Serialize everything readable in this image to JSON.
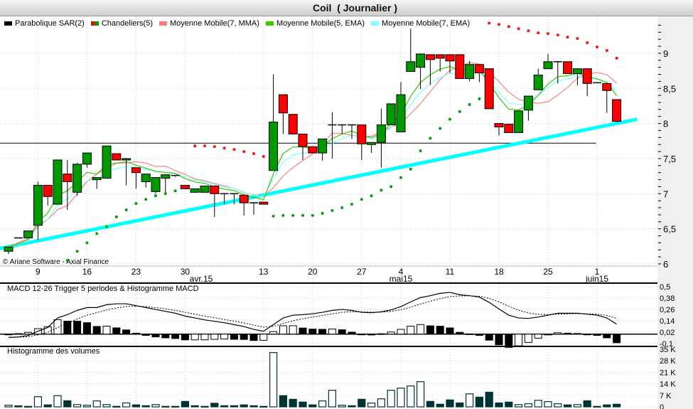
{
  "header": {
    "title": "Coil  ( Journalier )"
  },
  "legend": [
    {
      "label": "Parabolique SAR(2)",
      "colors": [
        "#000000"
      ]
    },
    {
      "label": "Chandeliers(5)",
      "colors": [
        "#ff0000",
        "#009900"
      ]
    },
    {
      "label": "Moyenne Mobile(7, MMA)",
      "colors": [
        "#ff7b7b"
      ]
    },
    {
      "label": "Moyenne Mobile(5, EMA)",
      "colors": [
        "#33cc00"
      ]
    },
    {
      "label": "Moyenne Mobile(7, EMA)",
      "colors": [
        "#80ffff"
      ]
    }
  ],
  "copyright": "© Ariane Software - Axial Finance",
  "colors": {
    "up": "#009900",
    "down": "#ff0000",
    "sma7": "#ff8080",
    "ema5": "#33cc00",
    "ema7": "#80ffff",
    "sar_up": "#00a000",
    "sar_down": "#ff1010",
    "support": "#00ffff",
    "volume": "#003333"
  },
  "price_axis": {
    "labels": [
      {
        "text": "9",
        "value": 9
      },
      {
        "text": "8,5",
        "value": 8.5
      },
      {
        "text": "8",
        "value": 8
      },
      {
        "text": "7,5",
        "value": 7.5
      },
      {
        "text": "7",
        "value": 7
      },
      {
        "text": "6,5",
        "value": 6.5
      },
      {
        "text": "6",
        "value": 6
      }
    ]
  },
  "date_ticks": [
    {
      "label": "9",
      "index": 3
    },
    {
      "label": "16",
      "index": 8
    },
    {
      "label": "23",
      "index": 13
    },
    {
      "label": "30",
      "index": 18
    },
    {
      "label": "13",
      "index": 26
    },
    {
      "label": "20",
      "index": 31
    },
    {
      "label": "27",
      "index": 36
    },
    {
      "label": "4",
      "index": 40
    },
    {
      "label": "11",
      "index": 45
    },
    {
      "label": "18",
      "index": 50
    },
    {
      "label": "25",
      "index": 55
    },
    {
      "label": "1",
      "index": 60
    }
  ],
  "month_labels": [
    {
      "label": "avr.15",
      "index": 20
    },
    {
      "label": "mai15",
      "index": 40
    },
    {
      "label": "juin15",
      "index": 60
    }
  ],
  "macd_panel": {
    "title": "MACD 12-26   Trigger 5 periodes & Histogramme MACD",
    "axis_labels": [
      {
        "text": "0,5",
        "value": 0.5
      },
      {
        "text": "0,38",
        "value": 0.38
      },
      {
        "text": "0,26",
        "value": 0.26
      },
      {
        "text": "0,14",
        "value": 0.14
      },
      {
        "text": "0,02",
        "value": 0.02
      },
      {
        "text": "-0,1",
        "value": -0.1
      }
    ]
  },
  "volume_panel": {
    "title": "Histogramme des volumes",
    "axis_labels": [
      {
        "text": "35 K",
        "value": 35
      },
      {
        "text": "28 K",
        "value": 28
      },
      {
        "text": "21 K",
        "value": 21
      },
      {
        "text": "14 K",
        "value": 14
      },
      {
        "text": "7 K",
        "value": 7
      },
      {
        "text": "0",
        "value": 0
      }
    ]
  },
  "chart_data": [
    {
      "type": "candlestick",
      "title": "Coil (Journalier)",
      "ylim": [
        5.98,
        9.46
      ],
      "ohlc": [
        [
          6.18,
          6.24,
          6.14,
          6.24
        ],
        [
          6.37,
          6.37,
          6.37,
          6.37
        ],
        [
          6.37,
          6.47,
          6.37,
          6.47
        ],
        [
          6.55,
          7.17,
          6.34,
          7.12
        ],
        [
          7.12,
          7.12,
          6.83,
          6.96
        ],
        [
          6.85,
          7.48,
          6.85,
          7.48
        ],
        [
          7.28,
          7.48,
          6.77,
          7.17
        ],
        [
          7.02,
          7.44,
          6.97,
          7.42
        ],
        [
          7.42,
          7.58,
          7.37,
          7.58
        ],
        [
          7.2,
          7.23,
          7.07,
          7.23
        ],
        [
          7.22,
          7.68,
          7.22,
          7.68
        ],
        [
          7.57,
          7.57,
          7.48,
          7.48
        ],
        [
          7.48,
          7.51,
          7.12,
          7.5
        ],
        [
          7.37,
          7.37,
          7.07,
          7.3
        ],
        [
          7.17,
          7.28,
          7.09,
          7.28
        ],
        [
          7.03,
          7.23,
          7.0,
          7.23
        ],
        [
          7.22,
          7.27,
          7.0,
          7.27
        ],
        [
          7.26,
          7.26,
          7.24,
          7.26
        ],
        [
          7.12,
          7.12,
          7.07,
          7.07
        ],
        [
          7.02,
          7.07,
          7.02,
          7.07
        ],
        [
          7.02,
          7.11,
          7.02,
          7.11
        ],
        [
          7.11,
          7.11,
          6.67,
          7.0
        ],
        [
          7.0,
          7.0,
          6.85,
          7.0
        ],
        [
          7.0,
          7.0,
          6.85,
          7.0
        ],
        [
          6.98,
          6.98,
          6.69,
          6.87
        ],
        [
          6.87,
          6.87,
          6.7,
          6.87
        ],
        [
          6.88,
          6.88,
          6.85,
          6.85
        ],
        [
          7.33,
          8.7,
          7.33,
          8.02
        ],
        [
          8.41,
          8.41,
          7.85,
          8.15
        ],
        [
          8.13,
          8.13,
          7.85,
          7.85
        ],
        [
          7.85,
          7.85,
          7.48,
          7.67
        ],
        [
          7.67,
          7.67,
          7.58,
          7.58
        ],
        [
          7.58,
          7.78,
          7.47,
          7.78
        ],
        [
          7.98,
          8.16,
          7.5,
          7.98
        ],
        [
          7.98,
          7.98,
          7.85,
          7.98
        ],
        [
          7.98,
          7.98,
          7.78,
          7.98
        ],
        [
          7.98,
          7.98,
          7.48,
          7.71
        ],
        [
          7.7,
          7.73,
          7.58,
          7.73
        ],
        [
          7.73,
          8.21,
          7.37,
          7.98
        ],
        [
          7.98,
          8.28,
          7.98,
          8.28
        ],
        [
          7.88,
          8.59,
          7.88,
          8.41
        ],
        [
          8.74,
          9.35,
          8.74,
          8.88
        ],
        [
          8.8,
          8.99,
          8.49,
          8.99
        ],
        [
          8.98,
          8.98,
          8.55,
          8.91
        ],
        [
          8.98,
          8.98,
          8.74,
          8.93
        ],
        [
          8.98,
          8.98,
          8.72,
          8.89
        ],
        [
          8.98,
          8.98,
          8.64,
          8.64
        ],
        [
          8.64,
          8.89,
          8.6,
          8.84
        ],
        [
          8.84,
          8.84,
          8.59,
          8.72
        ],
        [
          8.78,
          8.78,
          8.21,
          8.21
        ],
        [
          8.0,
          8.0,
          7.83,
          7.95
        ],
        [
          7.99,
          8.0,
          7.87,
          7.87
        ],
        [
          7.87,
          8.18,
          7.87,
          8.18
        ],
        [
          8.19,
          8.39,
          8.04,
          8.39
        ],
        [
          8.48,
          8.78,
          8.48,
          8.69
        ],
        [
          8.78,
          8.99,
          8.78,
          8.88
        ],
        [
          8.88,
          8.88,
          8.57,
          8.88
        ],
        [
          8.88,
          8.88,
          8.71,
          8.71
        ],
        [
          8.71,
          8.78,
          8.54,
          8.78
        ],
        [
          8.78,
          8.78,
          8.39,
          8.57
        ],
        [
          8.58,
          8.58,
          8.58,
          8.58
        ],
        [
          8.57,
          8.57,
          8.15,
          8.47
        ],
        [
          8.34,
          8.34,
          8.03,
          8.03
        ]
      ],
      "sar": [
        null,
        null,
        null,
        null,
        null,
        null,
        6.05,
        6.18,
        6.3,
        6.43,
        6.53,
        6.67,
        6.77,
        6.86,
        6.92,
        6.97,
        7.0,
        7.04,
        null,
        7.68,
        7.68,
        7.67,
        7.65,
        7.63,
        7.6,
        7.57,
        7.53,
        6.68,
        6.69,
        6.69,
        6.69,
        6.69,
        6.72,
        6.76,
        6.8,
        6.85,
        6.92,
        6.97,
        7.05,
        7.1,
        7.23,
        7.35,
        7.61,
        7.79,
        7.93,
        8.06,
        8.17,
        8.27,
        8.35,
        9.43,
        9.41,
        9.38,
        9.35,
        9.32,
        9.29,
        9.28,
        9.26,
        9.23,
        9.21,
        9.15,
        9.09,
        9.04,
        8.93
      ],
      "lines": [
        {
          "name": "resistance",
          "from": [
            -0.87,
            7.72
          ],
          "to": [
            59.9,
            7.72
          ]
        },
        {
          "name": "support",
          "from": [
            -0.87,
            6.22
          ],
          "to": [
            64.1,
            8.06
          ]
        }
      ]
    },
    {
      "type": "line",
      "title": "MACD 12-26 Trigger 5 periodes & Histogramme MACD",
      "ylim": [
        -0.1,
        0.5
      ],
      "macd": [
        -0.035,
        -0.03,
        -0.015,
        0.03,
        0.07,
        0.17,
        0.205,
        0.25,
        0.28,
        0.28,
        0.31,
        0.32,
        0.32,
        0.3,
        0.28,
        0.26,
        0.24,
        0.22,
        0.19,
        0.17,
        0.15,
        0.135,
        0.12,
        0.1,
        0.08,
        0.05,
        0.03,
        0.1,
        0.17,
        0.2,
        0.205,
        0.215,
        0.23,
        0.25,
        0.26,
        0.25,
        0.23,
        0.225,
        0.235,
        0.255,
        0.29,
        0.34,
        0.385,
        0.405,
        0.43,
        0.44,
        0.415,
        0.405,
        0.39,
        0.335,
        0.265,
        0.2,
        0.17,
        0.165,
        0.18,
        0.2,
        0.22,
        0.22,
        0.22,
        0.21,
        0.2,
        0.17,
        0.105
      ]
    },
    {
      "type": "bar",
      "title": "Histogramme des volumes",
      "ylabel": "K",
      "ylim": [
        0,
        35
      ],
      "values": [
        1.0,
        0.6,
        0.3,
        6.2,
        1.2,
        6.8,
        3.7,
        1.4,
        1.0,
        3.6,
        1.4,
        0.3,
        2.4,
        1.2,
        0.7,
        1.4,
        0.3,
        0.3,
        3.3,
        0.7,
        0.3,
        2.2,
        0.7,
        0.7,
        1.2,
        0.7,
        0.3,
        33,
        6.8,
        4.6,
        2.9,
        1.2,
        3.6,
        10.1,
        1.0,
        0.7,
        4.6,
        2.3,
        4.9,
        10.1,
        11.4,
        12.7,
        15.3,
        3.3,
        1.6,
        4.2,
        2.4,
        7.9,
        5.9,
        8.9,
        2.4,
        2.9,
        1.4,
        1.9,
        4.0,
        3.2,
        1.9,
        1.2,
        1.4,
        3.7,
        0.3,
        1.2,
        1.6
      ],
      "hollow": [
        1,
        0,
        0,
        1,
        0,
        1,
        0,
        1,
        1,
        1,
        1,
        0,
        1,
        0,
        0,
        1,
        0,
        0,
        0,
        0,
        0,
        0,
        0,
        0,
        0,
        0,
        0,
        1,
        0,
        0,
        0,
        0,
        1,
        1,
        1,
        0,
        0,
        1,
        1,
        1,
        1,
        1,
        1,
        0,
        0,
        0,
        0,
        1,
        0,
        0,
        0,
        0,
        1,
        1,
        1,
        1,
        1,
        0,
        1,
        0,
        0,
        0,
        0
      ]
    }
  ]
}
